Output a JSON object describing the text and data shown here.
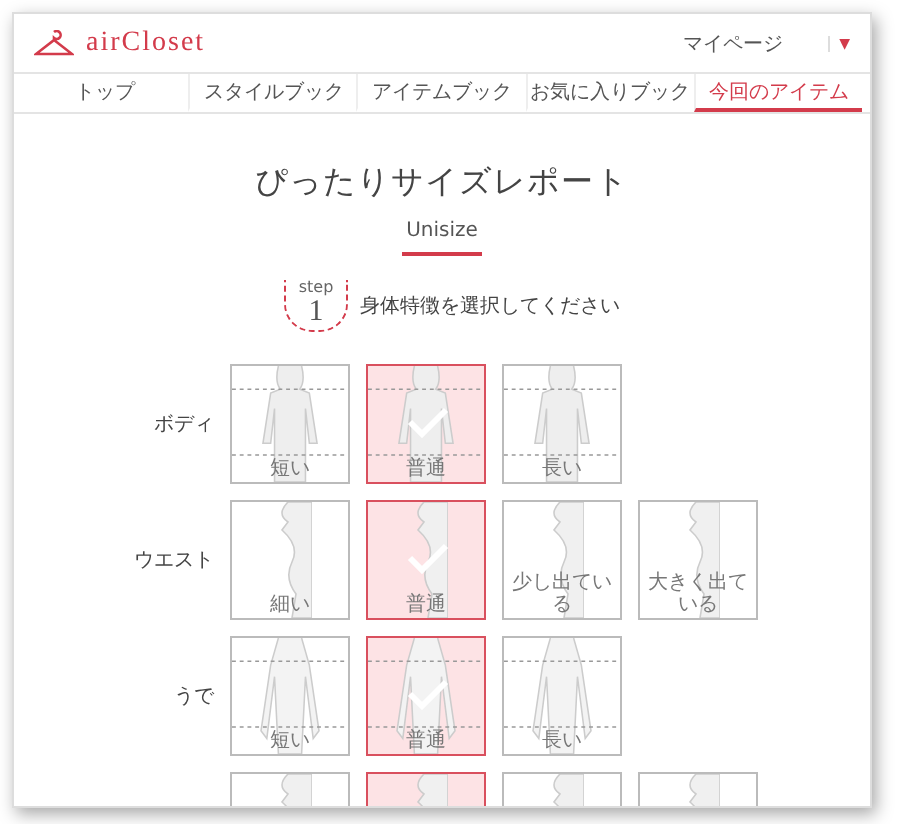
{
  "header": {
    "logo": "airCloset",
    "mypage": "マイページ",
    "dropdown": "▼"
  },
  "nav": [
    {
      "label": "トップ",
      "selected": false
    },
    {
      "label": "スタイルブック",
      "selected": false
    },
    {
      "label": "アイテムブック",
      "selected": false
    },
    {
      "label": "お気に入りブック",
      "selected": false
    },
    {
      "label": "今回のアイテム",
      "selected": true
    }
  ],
  "title": "ぴったりサイズレポート",
  "size_tab": {
    "label": "Unisize",
    "selected": true
  },
  "step": {
    "label": "step",
    "number": "1",
    "instruction": "身体特徴を選択してください"
  },
  "rows": [
    {
      "label": "ボディ",
      "kind": "front",
      "options": [
        {
          "label": "短い",
          "selected": false
        },
        {
          "label": "普通",
          "selected": true
        },
        {
          "label": "長い",
          "selected": false
        }
      ]
    },
    {
      "label": "ウエスト",
      "kind": "side",
      "options": [
        {
          "label": "細い",
          "selected": false
        },
        {
          "label": "普通",
          "selected": true
        },
        {
          "label": "少し出ている",
          "selected": false
        },
        {
          "label": "大きく出ている",
          "selected": false
        }
      ]
    },
    {
      "label": "うで",
      "kind": "arm",
      "options": [
        {
          "label": "短い",
          "selected": false
        },
        {
          "label": "普通",
          "selected": true
        },
        {
          "label": "長い",
          "selected": false
        }
      ]
    },
    {
      "kind": "side",
      "options": [
        {
          "selected": false
        },
        {
          "selected": true
        },
        {
          "selected": false
        },
        {
          "selected": false
        }
      ]
    }
  ]
}
